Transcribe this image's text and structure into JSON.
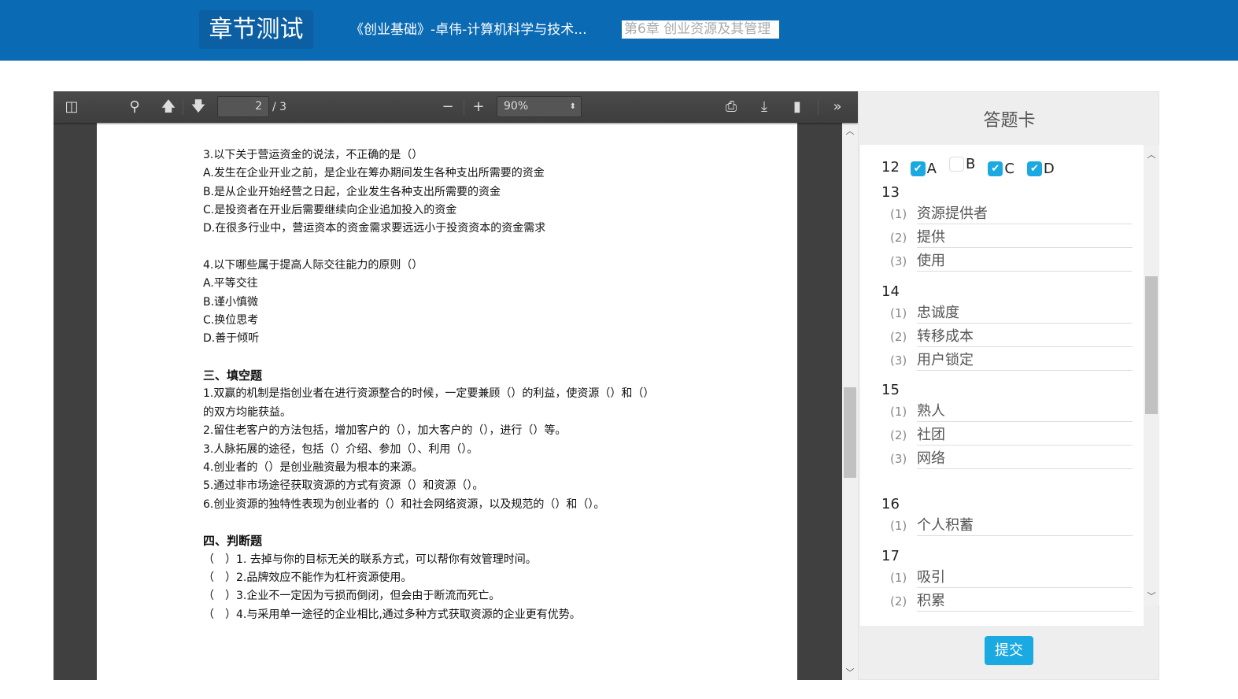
{
  "header": {
    "title": "章节测试",
    "course": "《创业基础》-卓伟-计算机科学与技术...",
    "chapter": "第6章 创业资源及其管理"
  },
  "toolbar": {
    "page_current": "2",
    "page_total": "/ 3",
    "zoom": "90%"
  },
  "document": {
    "lines": [
      {
        "t": "3.以下关于营运资金的说法，不正确的是（）"
      },
      {
        "t": "A.发生在企业开业之前，是企业在筹办期间发生各种支出所需要的资金"
      },
      {
        "t": "B.是从企业开始经营之日起，企业发生各种支出所需要的资金"
      },
      {
        "t": "C.是投资者在开业后需要继续向企业追加投入的资金"
      },
      {
        "t": "D.在很多行业中，营运资本的资金需求要远远小于投资资本的资金需求"
      },
      {
        "t": ""
      },
      {
        "t": "4.以下哪些属于提高人际交往能力的原则（）"
      },
      {
        "t": "A.平等交往"
      },
      {
        "t": "B.谨小慎微"
      },
      {
        "t": "C.换位思考"
      },
      {
        "t": "D.善于倾听"
      },
      {
        "t": ""
      },
      {
        "t": "三、填空题",
        "h": true
      },
      {
        "t": "1.双赢的机制是指创业者在进行资源整合的时候，一定要兼顾（）的利益，使资源（）和（）"
      },
      {
        "t": "的双方均能获益。"
      },
      {
        "t": "2.留住老客户的方法包括，增加客户的（），加大客户的（），进行（）等。"
      },
      {
        "t": "3.人脉拓展的途径，包括（）介绍、参加（）、利用（）。"
      },
      {
        "t": "4.创业者的（）是创业融资最为根本的来源。"
      },
      {
        "t": "5.通过非市场途径获取资源的方式有资源（）和资源（）。"
      },
      {
        "t": "6.创业资源的独特性表现为创业者的（）和社会网络资源，以及规范的（）和（）。"
      },
      {
        "t": ""
      },
      {
        "t": "四、判断题",
        "h": true
      },
      {
        "t": "（　）1. 去掉与你的目标无关的联系方式，可以帮你有效管理时间。"
      },
      {
        "t": "（　）2.品牌效应不能作为杠杆资源使用。"
      },
      {
        "t": "（　）3.企业不一定因为亏损而倒闭，但会由于断流而死亡。"
      },
      {
        "t": "（　）4.与采用单一途径的企业相比,通过多种方式获取资源的企业更有优势。"
      }
    ]
  },
  "answer_card": {
    "title": "答题卡",
    "q12": {
      "num": "12",
      "options": [
        {
          "label": "A",
          "checked": true
        },
        {
          "label": "B",
          "checked": false
        },
        {
          "label": "C",
          "checked": true
        },
        {
          "label": "D",
          "checked": true
        }
      ]
    },
    "groups": [
      {
        "num": "13",
        "items": [
          {
            "n": "(1)",
            "v": "资源提供者"
          },
          {
            "n": "(2)",
            "v": "提供"
          },
          {
            "n": "(3)",
            "v": "使用"
          }
        ]
      },
      {
        "num": "14",
        "items": [
          {
            "n": "(1)",
            "v": "忠诚度"
          },
          {
            "n": "(2)",
            "v": "转移成本"
          },
          {
            "n": "(3)",
            "v": "用户锁定"
          }
        ]
      },
      {
        "num": "15",
        "items": [
          {
            "n": "(1)",
            "v": "熟人"
          },
          {
            "n": "(2)",
            "v": "社团"
          },
          {
            "n": "(3)",
            "v": "网络"
          }
        ]
      },
      {
        "num": "16",
        "items": [
          {
            "n": "(1)",
            "v": "个人积蓄"
          }
        ]
      },
      {
        "num": "17",
        "items": [
          {
            "n": "(1)",
            "v": "吸引"
          },
          {
            "n": "(2)",
            "v": "积累"
          }
        ]
      }
    ],
    "submit": "提交"
  },
  "colors": {
    "header": "#0a6ab4",
    "accent": "#1aa9e0",
    "toolbar": "#474747"
  }
}
